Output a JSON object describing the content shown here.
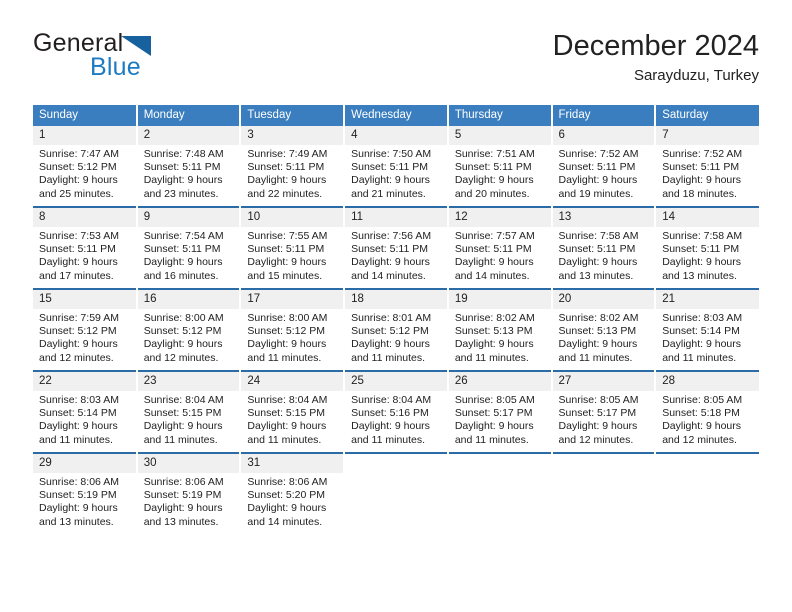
{
  "brand": {
    "word1": "General",
    "word2": "Blue",
    "triangle_color": "#17619e",
    "blue_text_color": "#1f7bc1"
  },
  "header": {
    "title": "December 2024",
    "subtitle": "Sarayduzu, Turkey"
  },
  "theme": {
    "header_bg": "#3a7ebf",
    "row_rule": "#2a6ba8",
    "daynum_bg": "#f0f0f0"
  },
  "weekday_headers": [
    "Sunday",
    "Monday",
    "Tuesday",
    "Wednesday",
    "Thursday",
    "Friday",
    "Saturday"
  ],
  "weeks": [
    [
      {
        "day": "1",
        "sunrise": "Sunrise: 7:47 AM",
        "sunset": "Sunset: 5:12 PM",
        "daylight1": "Daylight: 9 hours",
        "daylight2": "and 25 minutes."
      },
      {
        "day": "2",
        "sunrise": "Sunrise: 7:48 AM",
        "sunset": "Sunset: 5:11 PM",
        "daylight1": "Daylight: 9 hours",
        "daylight2": "and 23 minutes."
      },
      {
        "day": "3",
        "sunrise": "Sunrise: 7:49 AM",
        "sunset": "Sunset: 5:11 PM",
        "daylight1": "Daylight: 9 hours",
        "daylight2": "and 22 minutes."
      },
      {
        "day": "4",
        "sunrise": "Sunrise: 7:50 AM",
        "sunset": "Sunset: 5:11 PM",
        "daylight1": "Daylight: 9 hours",
        "daylight2": "and 21 minutes."
      },
      {
        "day": "5",
        "sunrise": "Sunrise: 7:51 AM",
        "sunset": "Sunset: 5:11 PM",
        "daylight1": "Daylight: 9 hours",
        "daylight2": "and 20 minutes."
      },
      {
        "day": "6",
        "sunrise": "Sunrise: 7:52 AM",
        "sunset": "Sunset: 5:11 PM",
        "daylight1": "Daylight: 9 hours",
        "daylight2": "and 19 minutes."
      },
      {
        "day": "7",
        "sunrise": "Sunrise: 7:52 AM",
        "sunset": "Sunset: 5:11 PM",
        "daylight1": "Daylight: 9 hours",
        "daylight2": "and 18 minutes."
      }
    ],
    [
      {
        "day": "8",
        "sunrise": "Sunrise: 7:53 AM",
        "sunset": "Sunset: 5:11 PM",
        "daylight1": "Daylight: 9 hours",
        "daylight2": "and 17 minutes."
      },
      {
        "day": "9",
        "sunrise": "Sunrise: 7:54 AM",
        "sunset": "Sunset: 5:11 PM",
        "daylight1": "Daylight: 9 hours",
        "daylight2": "and 16 minutes."
      },
      {
        "day": "10",
        "sunrise": "Sunrise: 7:55 AM",
        "sunset": "Sunset: 5:11 PM",
        "daylight1": "Daylight: 9 hours",
        "daylight2": "and 15 minutes."
      },
      {
        "day": "11",
        "sunrise": "Sunrise: 7:56 AM",
        "sunset": "Sunset: 5:11 PM",
        "daylight1": "Daylight: 9 hours",
        "daylight2": "and 14 minutes."
      },
      {
        "day": "12",
        "sunrise": "Sunrise: 7:57 AM",
        "sunset": "Sunset: 5:11 PM",
        "daylight1": "Daylight: 9 hours",
        "daylight2": "and 14 minutes."
      },
      {
        "day": "13",
        "sunrise": "Sunrise: 7:58 AM",
        "sunset": "Sunset: 5:11 PM",
        "daylight1": "Daylight: 9 hours",
        "daylight2": "and 13 minutes."
      },
      {
        "day": "14",
        "sunrise": "Sunrise: 7:58 AM",
        "sunset": "Sunset: 5:11 PM",
        "daylight1": "Daylight: 9 hours",
        "daylight2": "and 13 minutes."
      }
    ],
    [
      {
        "day": "15",
        "sunrise": "Sunrise: 7:59 AM",
        "sunset": "Sunset: 5:12 PM",
        "daylight1": "Daylight: 9 hours",
        "daylight2": "and 12 minutes."
      },
      {
        "day": "16",
        "sunrise": "Sunrise: 8:00 AM",
        "sunset": "Sunset: 5:12 PM",
        "daylight1": "Daylight: 9 hours",
        "daylight2": "and 12 minutes."
      },
      {
        "day": "17",
        "sunrise": "Sunrise: 8:00 AM",
        "sunset": "Sunset: 5:12 PM",
        "daylight1": "Daylight: 9 hours",
        "daylight2": "and 11 minutes."
      },
      {
        "day": "18",
        "sunrise": "Sunrise: 8:01 AM",
        "sunset": "Sunset: 5:12 PM",
        "daylight1": "Daylight: 9 hours",
        "daylight2": "and 11 minutes."
      },
      {
        "day": "19",
        "sunrise": "Sunrise: 8:02 AM",
        "sunset": "Sunset: 5:13 PM",
        "daylight1": "Daylight: 9 hours",
        "daylight2": "and 11 minutes."
      },
      {
        "day": "20",
        "sunrise": "Sunrise: 8:02 AM",
        "sunset": "Sunset: 5:13 PM",
        "daylight1": "Daylight: 9 hours",
        "daylight2": "and 11 minutes."
      },
      {
        "day": "21",
        "sunrise": "Sunrise: 8:03 AM",
        "sunset": "Sunset: 5:14 PM",
        "daylight1": "Daylight: 9 hours",
        "daylight2": "and 11 minutes."
      }
    ],
    [
      {
        "day": "22",
        "sunrise": "Sunrise: 8:03 AM",
        "sunset": "Sunset: 5:14 PM",
        "daylight1": "Daylight: 9 hours",
        "daylight2": "and 11 minutes."
      },
      {
        "day": "23",
        "sunrise": "Sunrise: 8:04 AM",
        "sunset": "Sunset: 5:15 PM",
        "daylight1": "Daylight: 9 hours",
        "daylight2": "and 11 minutes."
      },
      {
        "day": "24",
        "sunrise": "Sunrise: 8:04 AM",
        "sunset": "Sunset: 5:15 PM",
        "daylight1": "Daylight: 9 hours",
        "daylight2": "and 11 minutes."
      },
      {
        "day": "25",
        "sunrise": "Sunrise: 8:04 AM",
        "sunset": "Sunset: 5:16 PM",
        "daylight1": "Daylight: 9 hours",
        "daylight2": "and 11 minutes."
      },
      {
        "day": "26",
        "sunrise": "Sunrise: 8:05 AM",
        "sunset": "Sunset: 5:17 PM",
        "daylight1": "Daylight: 9 hours",
        "daylight2": "and 11 minutes."
      },
      {
        "day": "27",
        "sunrise": "Sunrise: 8:05 AM",
        "sunset": "Sunset: 5:17 PM",
        "daylight1": "Daylight: 9 hours",
        "daylight2": "and 12 minutes."
      },
      {
        "day": "28",
        "sunrise": "Sunrise: 8:05 AM",
        "sunset": "Sunset: 5:18 PM",
        "daylight1": "Daylight: 9 hours",
        "daylight2": "and 12 minutes."
      }
    ],
    [
      {
        "day": "29",
        "sunrise": "Sunrise: 8:06 AM",
        "sunset": "Sunset: 5:19 PM",
        "daylight1": "Daylight: 9 hours",
        "daylight2": "and 13 minutes."
      },
      {
        "day": "30",
        "sunrise": "Sunrise: 8:06 AM",
        "sunset": "Sunset: 5:19 PM",
        "daylight1": "Daylight: 9 hours",
        "daylight2": "and 13 minutes."
      },
      {
        "day": "31",
        "sunrise": "Sunrise: 8:06 AM",
        "sunset": "Sunset: 5:20 PM",
        "daylight1": "Daylight: 9 hours",
        "daylight2": "and 14 minutes."
      },
      {
        "day": "",
        "sunrise": "",
        "sunset": "",
        "daylight1": "",
        "daylight2": ""
      },
      {
        "day": "",
        "sunrise": "",
        "sunset": "",
        "daylight1": "",
        "daylight2": ""
      },
      {
        "day": "",
        "sunrise": "",
        "sunset": "",
        "daylight1": "",
        "daylight2": ""
      },
      {
        "day": "",
        "sunrise": "",
        "sunset": "",
        "daylight1": "",
        "daylight2": ""
      }
    ]
  ]
}
